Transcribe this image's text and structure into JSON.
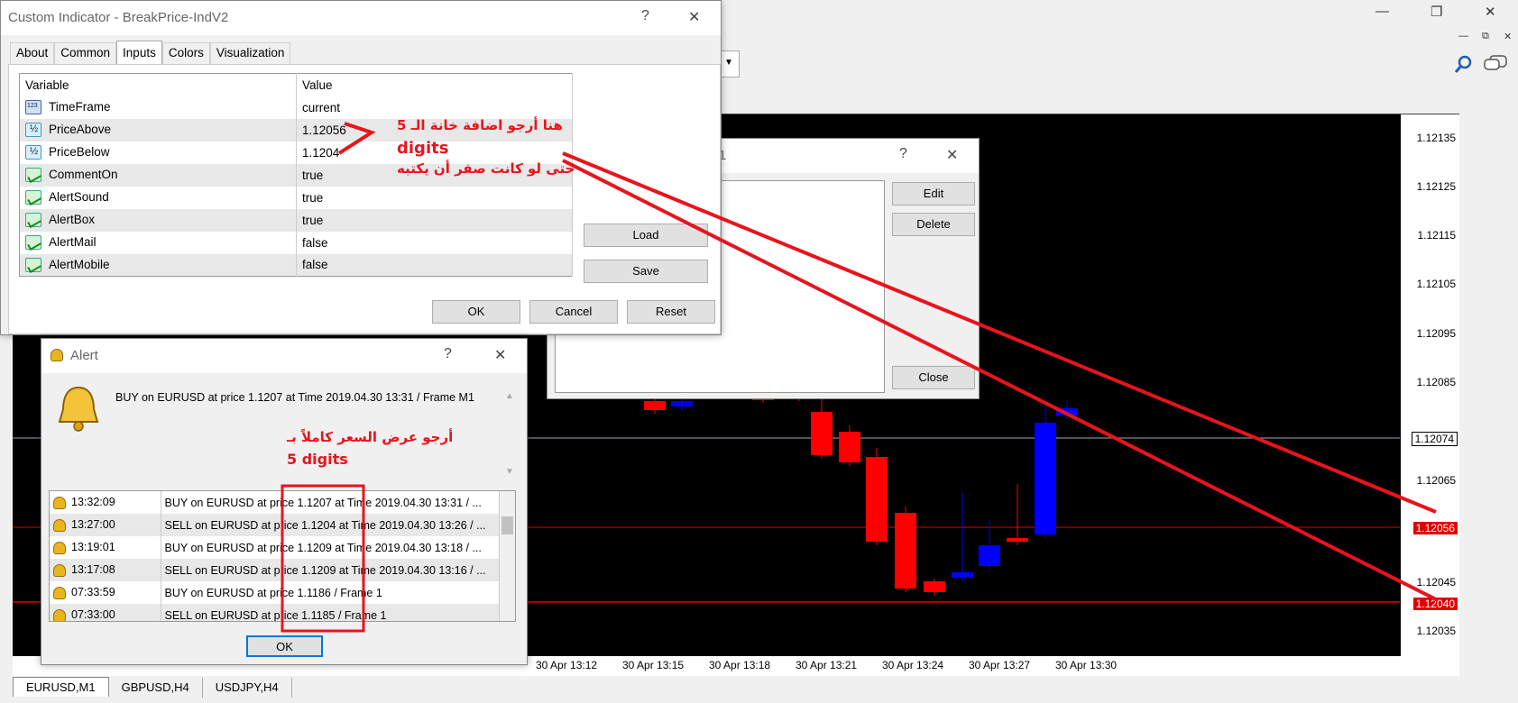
{
  "main_window": {
    "minimize": "—",
    "maximize": "❐",
    "close": "✕",
    "inner_minimize": "—",
    "inner_restore": "⧉",
    "inner_close": "✕"
  },
  "chart": {
    "price_labels": [
      "1.12135",
      "1.12125",
      "1.12115",
      "1.12105",
      "1.12095",
      "1.12085",
      "1.12065",
      "1.12045",
      "1.12035"
    ],
    "price_tags": {
      "current": "1.12074",
      "above": "1.12056",
      "below": "1.12040"
    },
    "time_labels": [
      "30 Apr 13:12",
      "30 Apr 13:15",
      "30 Apr 13:18",
      "30 Apr 13:21",
      "30 Apr 13:24",
      "30 Apr 13:27",
      "30 Apr 13:30"
    ],
    "colors": {
      "bull": "#0000ff",
      "bear": "#ff0000",
      "line_red": "#e00000",
      "bg": "#000000"
    }
  },
  "tabs": [
    "EURUSD,M1",
    "GBPUSD,H4",
    "USDJPY,H4"
  ],
  "indicator_dialog": {
    "title": "Custom Indicator - BreakPrice-IndV2",
    "help": "?",
    "close": "✕",
    "tabs": [
      "About",
      "Common",
      "Inputs",
      "Colors",
      "Visualization"
    ],
    "selected_tab": "Inputs",
    "columns": [
      "Variable",
      "Value"
    ],
    "rows": [
      {
        "icon": "number-icon",
        "variable": "TimeFrame",
        "value": "current"
      },
      {
        "icon": "fraction-icon",
        "variable": "PriceAbove",
        "value": "1.12056"
      },
      {
        "icon": "fraction-icon",
        "variable": "PriceBelow",
        "value": "1.1204"
      },
      {
        "icon": "bool-icon",
        "variable": "CommentOn",
        "value": "true"
      },
      {
        "icon": "bool-icon",
        "variable": "AlertSound",
        "value": "true"
      },
      {
        "icon": "bool-icon",
        "variable": "AlertBox",
        "value": "true"
      },
      {
        "icon": "bool-icon",
        "variable": "AlertMail",
        "value": "false"
      },
      {
        "icon": "bool-icon",
        "variable": "AlertMobile",
        "value": "false"
      }
    ],
    "load": "Load",
    "save": "Save",
    "ok": "OK",
    "cancel": "Cancel",
    "reset": "Reset"
  },
  "back_dialog": {
    "title_suffix": "1",
    "help": "?",
    "close": "✕",
    "edit": "Edit",
    "delete": "Delete",
    "close_button": "Close"
  },
  "alert_dialog": {
    "title": "Alert",
    "help": "?",
    "close": "✕",
    "message": "BUY on EURUSD at price 1.1207 at Time 2019.04.30 13:31 / Frame M1",
    "rows": [
      {
        "time": "13:32:09",
        "text": "BUY on EURUSD at price 1.1207 at Time 2019.04.30 13:31 / ..."
      },
      {
        "time": "13:27:00",
        "text": "SELL on EURUSD at price 1.1204 at Time 2019.04.30 13:26 / ..."
      },
      {
        "time": "13:19:01",
        "text": "BUY on EURUSD at price 1.1209 at Time 2019.04.30 13:18 / ..."
      },
      {
        "time": "13:17:08",
        "text": "SELL on EURUSD at price 1.1209 at Time 2019.04.30 13:16 / ..."
      },
      {
        "time": "07:33:59",
        "text": "BUY on EURUSD at price 1.1186 / Frame 1"
      },
      {
        "time": "07:33:00",
        "text": "SELL on EURUSD at price 1.1185 / Frame 1"
      }
    ],
    "ok": "OK"
  },
  "annotations": {
    "line1": "هنا أرجو اضافة خانة الـ 5",
    "line2": "digits",
    "line3": "حتى لو كانت صفر أن يكتبه",
    "alert_line1": "أرجو عرض السعر كاملاً بـ",
    "alert_line2": "5 digits"
  }
}
